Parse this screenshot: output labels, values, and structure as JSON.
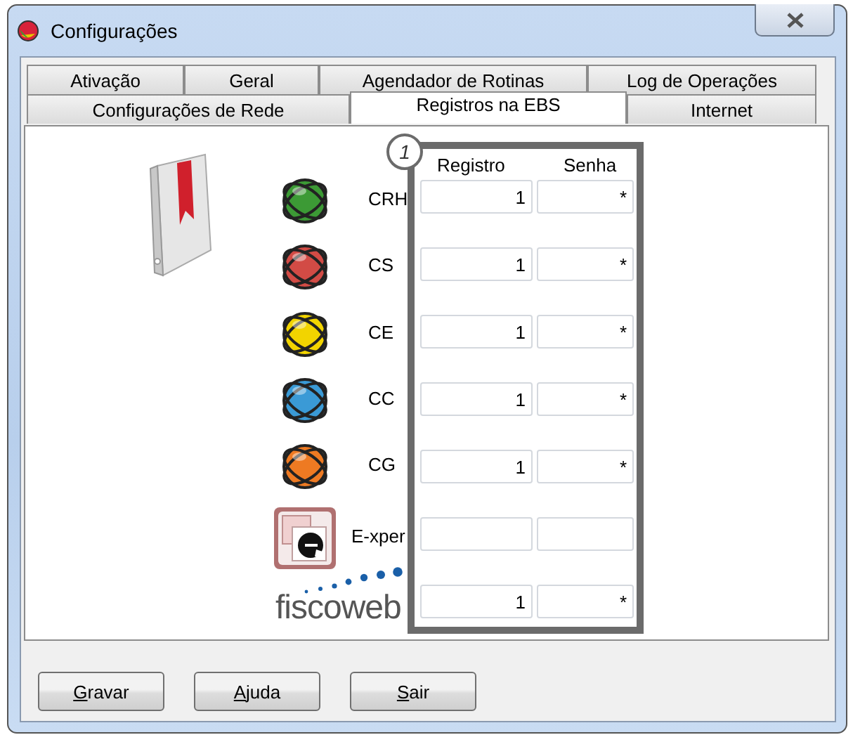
{
  "window": {
    "title": "Configurações"
  },
  "tab_rows": [
    [
      {
        "label": "Ativação",
        "selected": false
      },
      {
        "label": "Geral",
        "selected": false
      },
      {
        "label": "Agendador de Rotinas",
        "selected": false
      },
      {
        "label": "Log de Operações",
        "selected": false
      }
    ],
    [
      {
        "label": "Configurações de Rede",
        "selected": false
      },
      {
        "label": "Registros na EBS",
        "selected": true
      },
      {
        "label": "Internet",
        "selected": false
      }
    ]
  ],
  "panel": {
    "callout": "1",
    "columns": [
      "Registro",
      "Senha"
    ],
    "systems": [
      {
        "kind": "orb",
        "color": "#3c9a35",
        "label": "CRH",
        "registro": "1",
        "senha": "*"
      },
      {
        "kind": "orb",
        "color": "#d24b45",
        "label": "CS",
        "registro": "1",
        "senha": "*"
      },
      {
        "kind": "orb",
        "color": "#f2d400",
        "label": "CE",
        "registro": "1",
        "senha": "*"
      },
      {
        "kind": "orb",
        "color": "#3a9ad6",
        "label": "CC",
        "registro": "1",
        "senha": "*"
      },
      {
        "kind": "orb",
        "color": "#ee7a22",
        "label": "CG",
        "registro": "1",
        "senha": "*"
      },
      {
        "kind": "expert",
        "label": "E-xper"
      },
      {
        "kind": "logo",
        "label": "fiscoweb",
        "registro": "1",
        "senha": "*"
      }
    ]
  },
  "buttons": [
    "Gravar",
    "Ajuda",
    "Sair"
  ]
}
